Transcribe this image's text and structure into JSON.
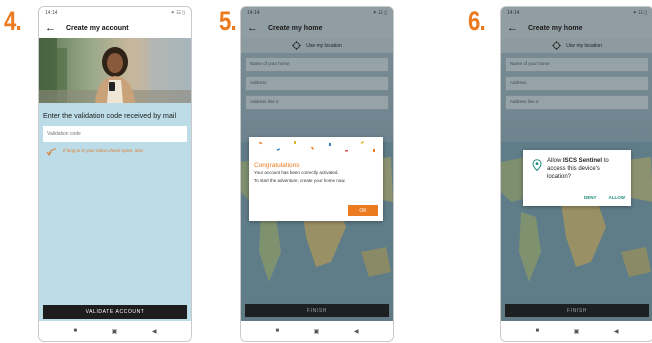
{
  "steps": [
    "4.",
    "5.",
    "6."
  ],
  "status": {
    "time": "14:14",
    "icons": "✶ ☷ ▯"
  },
  "phone4": {
    "title": "Create my account",
    "validation_text": "Enter the validation code received by mail",
    "code_placeholder": "Validation code",
    "hint": "If long to in your inbox check spam, also",
    "button": "VALIDATE ACCOUNT"
  },
  "phone5": {
    "title": "Create my home",
    "location": "Use my location",
    "fields": [
      "Name of your home",
      "Address",
      "Address line 2"
    ],
    "dialog": {
      "title": "Congratulations",
      "line1": "Your account has been correctly activated.",
      "line2": "To start the adventure, create your home now.",
      "ok": "OK"
    },
    "finish": "FINISH"
  },
  "phone6": {
    "title": "Create my home",
    "location": "Use my location",
    "fields": [
      "Name of your home",
      "Address",
      "Address line 2"
    ],
    "dialog": {
      "prefix": "Allow ",
      "app": "ISCS Sentinel",
      "suffix": " to access this device's location?",
      "deny": "DENY",
      "allow": "ALLOW"
    },
    "finish": "FINISH"
  },
  "nav": {
    "home": "■",
    "overview": "▣",
    "back": "◀"
  },
  "colors": {
    "accent": "#ec7a1f",
    "teal": "#1c8a7a",
    "dark_button": "#1d1d1d"
  }
}
